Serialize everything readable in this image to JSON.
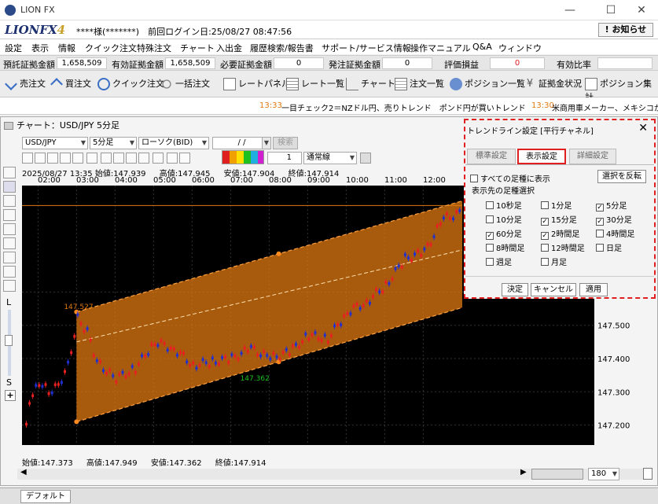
{
  "window": {
    "title": "LION FX",
    "min": "—",
    "max": "☐",
    "close": "✕"
  },
  "brand": {
    "logo": "LIONFX",
    "logo_suffix": "4",
    "user": "****様(*******)　前回ログイン日:25/08/27 08:47:56",
    "notice": "! お知らせ"
  },
  "menu": [
    "設定",
    "表示",
    "情報",
    "クイック注文",
    "特殊注文",
    "チャート",
    "入出金",
    "履歴検索/報告書",
    "サポート/サービス情報",
    "操作マニュアル",
    "Q&A",
    "ウィンドウ"
  ],
  "status": [
    {
      "label": "預託証拠金額",
      "value": "1,658,509"
    },
    {
      "label": "有効証拠金額",
      "value": "1,658,509"
    },
    {
      "label": "必要証拠金額",
      "value": "0"
    },
    {
      "label": "発注証拠金額",
      "value": "0"
    },
    {
      "label": "評価損益",
      "value": "0"
    },
    {
      "label": "有効比率",
      "value": ""
    }
  ],
  "toolbar": [
    "売注文",
    "買注文",
    "クイック注文",
    "一括注文",
    "レートパネル",
    "レート一覧",
    "チャート",
    "注文一覧",
    "ポジション一覧",
    "証拠金状況",
    "ポジション集計"
  ],
  "ticker": [
    {
      "time": "13:33",
      "text": "一目チェック2＝NZドル円、売りトレンド　ポンド円が買いトレンド"
    },
    {
      "time": "13:30",
      "text": "米商用車メーカー、メキシコから"
    }
  ],
  "chart": {
    "title": "チャート：USD/JPY 5分足",
    "pair": "USD/JPY",
    "interval": "5分足",
    "candle_type": "ローソク(BID)",
    "date_input": "/ /",
    "search": "検索",
    "line_width": "1",
    "line_style": "通常線",
    "top_ohlc": {
      "date": "2025/08/27 13:35",
      "open": "始値:147.939",
      "high": "高値:147.945",
      "low": "安値:147.904",
      "close": "終値:147.914"
    },
    "bottom_ohlc": {
      "open": "始値:147.373",
      "high": "高値:147.949",
      "low": "安値:147.362",
      "close": "終値:147.914"
    },
    "left_labels": {
      "L": "L",
      "S": "S",
      "plus": "+"
    },
    "zoom": "180",
    "tab": "デフォルト",
    "channel_high_label": "147.527",
    "channel_low_label": "147.362"
  },
  "chart_data": {
    "type": "line",
    "pair": "USD/JPY",
    "interval": "5分足",
    "x_ticks": [
      "02:00",
      "03:00",
      "04:00",
      "05:00",
      "06:00",
      "07:00",
      "08:00",
      "09:00",
      "10:00",
      "11:00",
      "12:00"
    ],
    "y_ticks": [
      147.2,
      147.3,
      147.4,
      147.5,
      147.6
    ],
    "ylim": [
      147.14,
      147.92
    ],
    "horizontal_line": 147.86,
    "channel": {
      "upper_start": 147.54,
      "upper_end": 147.89,
      "mid_start": 147.45,
      "mid_end": 147.74,
      "lower_start": 147.21,
      "lower_end": 147.57
    },
    "price_path": [
      {
        "t": "01:40",
        "v": 147.21
      },
      {
        "t": "01:50",
        "v": 147.3
      },
      {
        "t": "02:00",
        "v": 147.33
      },
      {
        "t": "02:15",
        "v": 147.3
      },
      {
        "t": "02:30",
        "v": 147.32
      },
      {
        "t": "02:45",
        "v": 147.38
      },
      {
        "t": "03:00",
        "v": 147.52
      },
      {
        "t": "03:15",
        "v": 147.48
      },
      {
        "t": "03:30",
        "v": 147.39
      },
      {
        "t": "03:45",
        "v": 147.36
      },
      {
        "t": "04:00",
        "v": 147.34
      },
      {
        "t": "04:30",
        "v": 147.37
      },
      {
        "t": "05:00",
        "v": 147.45
      },
      {
        "t": "05:30",
        "v": 147.43
      },
      {
        "t": "06:00",
        "v": 147.38
      },
      {
        "t": "06:30",
        "v": 147.39
      },
      {
        "t": "07:00",
        "v": 147.4
      },
      {
        "t": "07:30",
        "v": 147.43
      },
      {
        "t": "08:00",
        "v": 147.4
      },
      {
        "t": "08:30",
        "v": 147.42
      },
      {
        "t": "09:00",
        "v": 147.47
      },
      {
        "t": "09:30",
        "v": 147.46
      },
      {
        "t": "10:00",
        "v": 147.54
      },
      {
        "t": "10:30",
        "v": 147.57
      },
      {
        "t": "11:00",
        "v": 147.62
      },
      {
        "t": "11:30",
        "v": 147.7
      },
      {
        "t": "12:00",
        "v": 147.72
      },
      {
        "t": "12:30",
        "v": 147.82
      },
      {
        "t": "13:00",
        "v": 147.84
      }
    ]
  },
  "dialog": {
    "title": "トレンドライン設定 [平行チャネル]",
    "close": "✕",
    "tabs": [
      "標準設定",
      "表示設定",
      "詳細設定"
    ],
    "all_label": "すべての足種に表示",
    "invert": "選択を反転",
    "section": "表示先の足種選択",
    "options": [
      {
        "label": "10秒足",
        "checked": false
      },
      {
        "label": "1分足",
        "checked": false
      },
      {
        "label": "5分足",
        "checked": true
      },
      {
        "label": "10分足",
        "checked": false
      },
      {
        "label": "15分足",
        "checked": true
      },
      {
        "label": "30分足",
        "checked": true
      },
      {
        "label": "60分足",
        "checked": true
      },
      {
        "label": "2時間足",
        "checked": true
      },
      {
        "label": "4時間足",
        "checked": false
      },
      {
        "label": "8時間足",
        "checked": false
      },
      {
        "label": "12時間足",
        "checked": false
      },
      {
        "label": "日足",
        "checked": false
      },
      {
        "label": "週足",
        "checked": false
      },
      {
        "label": "月足",
        "checked": false
      }
    ],
    "buttons": [
      "決定",
      "キャンセル",
      "適用"
    ]
  },
  "colors": {
    "accent_red": "#e02020",
    "channel": "#e07a10",
    "bull": "#e82020",
    "bear": "#2030d0"
  }
}
